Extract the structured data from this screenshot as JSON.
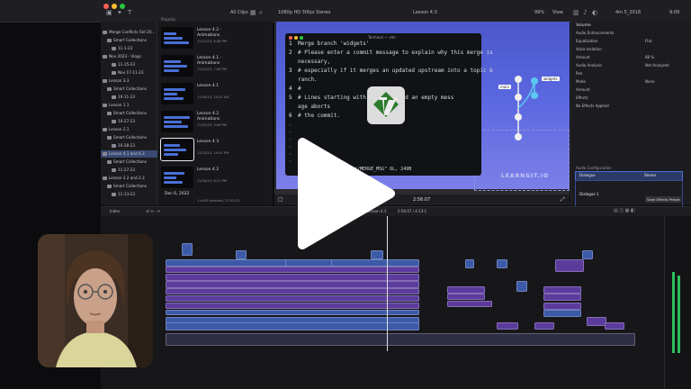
{
  "topbar": {
    "library_toggle": "All Clips",
    "format": "1080p HD 30fps Stereo",
    "clip_name": "Lesson 4.3",
    "zoom": "99%",
    "view": "View",
    "timecode_dur": "4m 5_2018",
    "right_label": "9:09"
  },
  "library": {
    "items": [
      {
        "label": "Merge Conflicts Fall 20...",
        "type": "library"
      },
      {
        "label": "Smart Collections",
        "type": "folder"
      },
      {
        "label": "11-1-23",
        "type": "event"
      },
      {
        "label": "Nov 2023 - Vlogs",
        "type": "library"
      },
      {
        "label": "11-15-23",
        "type": "event"
      },
      {
        "label": "Nov 17-11-23",
        "type": "event"
      },
      {
        "label": "Lesson 3.3",
        "type": "library"
      },
      {
        "label": "Smart Collections",
        "type": "folder"
      },
      {
        "label": "10-11-23",
        "type": "event"
      },
      {
        "label": "Lesson 1.1",
        "type": "library"
      },
      {
        "label": "Smart Collections",
        "type": "folder"
      },
      {
        "label": "10-27-23",
        "type": "event"
      },
      {
        "label": "Lesson 2.1",
        "type": "library"
      },
      {
        "label": "Smart Collections",
        "type": "folder"
      },
      {
        "label": "10-28-23",
        "type": "event"
      },
      {
        "label": "Lesson 4.1 and 4.3",
        "type": "library",
        "selected": true
      },
      {
        "label": "Smart Collections",
        "type": "folder"
      },
      {
        "label": "11-27-23",
        "type": "event"
      },
      {
        "label": "Lesson 2.2 and 2.3",
        "type": "library"
      },
      {
        "label": "Smart Collections",
        "type": "folder"
      },
      {
        "label": "11-13-23",
        "type": "event"
      }
    ]
  },
  "browser": {
    "header": "Projects",
    "clips": [
      {
        "title": "Lesson 4.2 -",
        "sub": "Animations",
        "meta": "11/21/23, 8:46 PM"
      },
      {
        "title": "Lesson 4.1 -",
        "sub": "Animations",
        "meta": "11/21/23, 7:06 PM"
      },
      {
        "title": "Lesson 4.1",
        "sub": "",
        "meta": "11/20/23, 10:51 AM"
      },
      {
        "title": "Lesson 4.2",
        "sub": "Animations",
        "meta": "11/20/23, 3:08 PM"
      },
      {
        "title": "Lesson 4.3",
        "sub": "",
        "meta": "11/23/23, 10:51 PM",
        "selected": true
      },
      {
        "title": "Lesson 4.2",
        "sub": "",
        "meta": "11/18/23, 8:11 PM"
      }
    ],
    "date_group": "Dec 6, 2022",
    "footer": "1 of 63 selected, 27:55:21"
  },
  "terminal": {
    "title": "Terminal — vim",
    "lines": [
      {
        "n": "1",
        "text": "Merge branch 'widgets'"
      },
      {
        "n": "2",
        "text": "# Please enter a commit message to explain why this merge is"
      },
      {
        "n": "",
        "text": "  necessary,"
      },
      {
        "n": "3",
        "text": "# especially if it merges an updated upstream into a topic b"
      },
      {
        "n": "",
        "text": "  ranch."
      },
      {
        "n": "4",
        "text": "#"
      },
      {
        "n": "5",
        "text": "# Lines starting with        ignored, and an empty mess"
      },
      {
        "n": "",
        "text": "  age aborts"
      },
      {
        "n": "6",
        "text": "# the commit."
      }
    ],
    "status": ".git/MERGE_MSG\" 6L, 249B"
  },
  "git_graph": {
    "branch_main": "main",
    "branch_widgets": "widgets"
  },
  "viewer": {
    "watermark": "LEARNGIT.IO",
    "timecode": "2:56:07",
    "play_icon": "play-icon"
  },
  "inspector": {
    "title": "Volume",
    "items": [
      {
        "label": "Audio Enhancements",
        "value": ""
      },
      {
        "label": "Equalization",
        "value": "Flat"
      },
      {
        "label": "Voice Isolation",
        "value": ""
      },
      {
        "label": "Amount",
        "value": "88 %"
      },
      {
        "label": "Audio Analysis",
        "value": "Not Analyzed"
      },
      {
        "label": "Pan",
        "value": ""
      },
      {
        "label": "Mode",
        "value": "None"
      },
      {
        "label": "Amount",
        "value": ""
      },
      {
        "label": "Effects",
        "value": ""
      },
      {
        "label": "No Effects Applied",
        "value": ""
      }
    ],
    "config_header": "Audio Configuration",
    "config_rows": [
      "Dialogue",
      "Dialogue 1"
    ],
    "config_value": "Stereo",
    "save_button": "Save Effects Preset"
  },
  "timeline": {
    "index_label": "Index",
    "project": "Lesson 4.3",
    "duration": "2:56:07 / 4:13:1"
  },
  "colors": {
    "accent": "#4a6fd6",
    "selection": "#3a4a72",
    "clip_purple": "#5b3c9c",
    "clip_blue": "#3d5aa8",
    "clip_green": "#2e8a66",
    "terminal_bg": "#101216"
  }
}
